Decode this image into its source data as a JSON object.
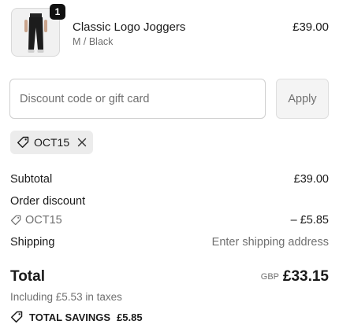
{
  "line_item": {
    "quantity": "1",
    "name": "Classic Logo Joggers",
    "variant": "M / Black",
    "price": "£39.00"
  },
  "discount": {
    "placeholder": "Discount code or gift card",
    "apply_label": "Apply",
    "applied_code": "OCT15"
  },
  "summary": {
    "subtotal_label": "Subtotal",
    "subtotal_value": "£39.00",
    "order_discount_label": "Order discount",
    "discount_code": "OCT15",
    "discount_value": "– £5.85",
    "shipping_label": "Shipping",
    "shipping_value": "Enter shipping address",
    "total_label": "Total",
    "currency": "GBP",
    "total_value": "£33.15",
    "taxes_note": "Including £5.53 in taxes",
    "savings_label": "TOTAL SAVINGS",
    "savings_value": "£5.85"
  },
  "icons": {
    "tag": "tag-icon",
    "close": "close-icon"
  }
}
